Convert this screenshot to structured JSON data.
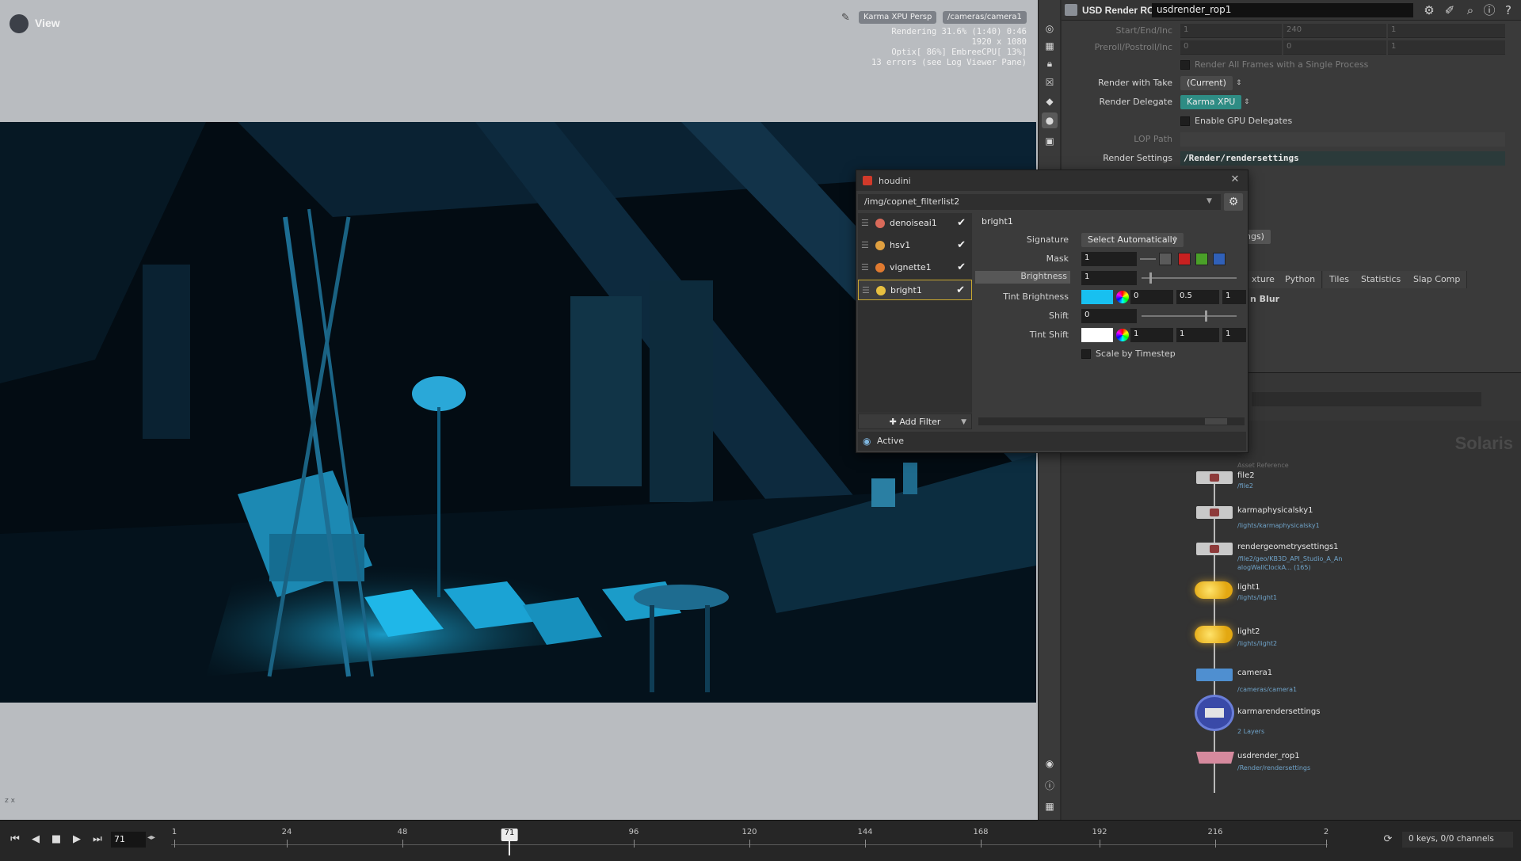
{
  "viewport": {
    "title": "View",
    "renderer_menu": "Karma XPU Persp",
    "camera_menu": "/cameras/camera1",
    "status": [
      "Rendering  31.6%  (1:40)  0:46",
      "1920 x 1080",
      "Optix[ 86%] EmbreeCPU[ 13%]",
      "13 errors (see Log Viewer Pane)"
    ],
    "axis_label": "z x"
  },
  "rop": {
    "type": "USD Render ROP",
    "name": "usdrender_rop1",
    "start_end_inc_label": "Start/End/Inc",
    "start_end_inc": [
      "1",
      "240",
      "1"
    ],
    "preroll_label": "Preroll/Postroll/Inc",
    "preroll": [
      "0",
      "0",
      "1"
    ],
    "render_all_frames_label": "Render All Frames with a Single Process",
    "render_with_take_label": "Render with Take",
    "render_with_take": "(Current)",
    "render_delegate_label": "Render Delegate",
    "render_delegate": "Karma XPU",
    "enable_gpu_label": "Enable GPU Delegates",
    "lop_path_label": "LOP Path",
    "render_settings_label": "Render Settings",
    "render_settings": "/Render/rendersettings",
    "camera_menu_fragment": "ngs)",
    "tabs": [
      "xture",
      "Python",
      "Tiles",
      "Statistics",
      "Slap Comp"
    ],
    "section_fragment": "n Blur"
  },
  "network": {
    "context_label": "Solaris",
    "nodes": [
      {
        "ref": "Asset Reference",
        "name": "file2",
        "sub": "/file2"
      },
      {
        "name": "karmaphysicalsky1",
        "sub": "/lights/karmaphysicalsky1"
      },
      {
        "name": "rendergeometrysettings1",
        "sub": "/file2/geo/KB3D_API_Studio_A_An",
        "sub2": "alogWallClockA... (165)"
      },
      {
        "name": "light1",
        "sub": "/lights/light1"
      },
      {
        "name": "light2",
        "sub": "/lights/light2"
      },
      {
        "name": "camera1",
        "sub": "/cameras/camera1"
      },
      {
        "name": "karmarendersettings",
        "sub": "2 Layers"
      },
      {
        "name": "usdrender_rop1",
        "sub": "/Render/rendersettings"
      }
    ]
  },
  "filter_window": {
    "title": "houdini",
    "path": "/img/copnet_filterlist2",
    "filters": [
      {
        "name": "denoiseai1",
        "icon_color": "#d96a5a"
      },
      {
        "name": "hsv1",
        "icon_color": "#e0a040"
      },
      {
        "name": "vignette1",
        "icon_color": "#e07a30"
      },
      {
        "name": "bright1",
        "icon_color": "#e8c040"
      }
    ],
    "add_filter_label": "Add Filter",
    "active_label": "Active",
    "params": {
      "node_name": "bright1",
      "signature_label": "Signature",
      "signature_value": "Select Automatically",
      "mask_label": "Mask",
      "mask_value": "1",
      "brightness_label": "Brightness",
      "brightness_value": "1",
      "tint_brightness_label": "Tint Brightness",
      "tint_brightness_values": [
        "0",
        "0.5",
        "1"
      ],
      "tint_brightness_color": "#18c0f0",
      "shift_label": "Shift",
      "shift_value": "0",
      "tint_shift_label": "Tint Shift",
      "tint_shift_values": [
        "1",
        "1",
        "1"
      ],
      "tint_shift_color": "#ffffff",
      "scale_by_timestep_label": "Scale by Timestep"
    }
  },
  "timeline": {
    "current_frame": "71",
    "ticks": [
      "1",
      "24",
      "48",
      "71",
      "96",
      "120",
      "144",
      "168",
      "192",
      "216",
      "2"
    ],
    "keys_status": "0 keys, 0/0 channels"
  }
}
